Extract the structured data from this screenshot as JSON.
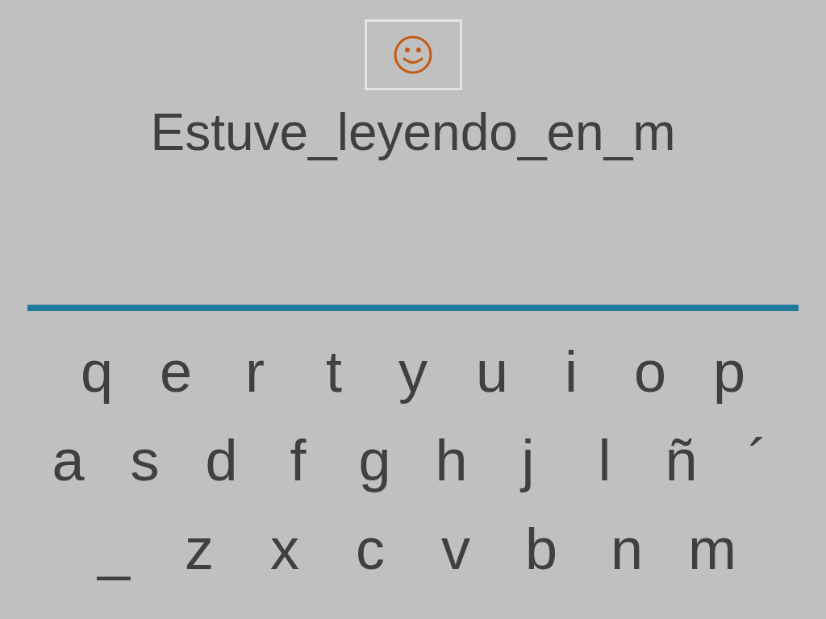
{
  "word": "Estuve_leyendo_en_m",
  "keyboard": {
    "rows": [
      {
        "keys": [
          "q",
          "e",
          "r",
          "t",
          "y",
          "u",
          "i",
          "o",
          "p"
        ]
      },
      {
        "keys": [
          "a",
          "s",
          "d",
          "f",
          "g",
          "h",
          "j",
          "l",
          "ñ",
          "´"
        ]
      },
      {
        "keys": [
          "_",
          "z",
          "x",
          "c",
          "v",
          "b",
          "n",
          "m"
        ]
      }
    ]
  }
}
